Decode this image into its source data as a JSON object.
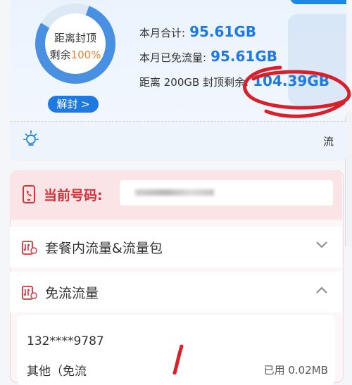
{
  "usage": {
    "ring_label_line1": "距离封顶",
    "ring_label_line2_prefix": "剩余",
    "ring_percent": "100%",
    "ring_fill_fraction": 0.78,
    "unlock_button": "解封",
    "unlock_chevron": ">",
    "month_total_label": "本月合计:",
    "month_total_value": "95.61GB",
    "month_free_label": "本月已免流量:",
    "month_free_value": "95.61GB",
    "cap_label": "距离 200GB 封顶剩余:",
    "cap_value": "104.39GB"
  },
  "tip": {
    "icon": "lightbulb-icon",
    "text": "流"
  },
  "number_panel": {
    "label": "当前号码:",
    "icon": "phone-icon"
  },
  "accordion": [
    {
      "title": "套餐内流量&流量包",
      "icon": "data-package-icon",
      "expanded": false
    },
    {
      "title": "免流流量",
      "icon": "free-data-icon",
      "expanded": true
    }
  ],
  "detail": {
    "number": "132****9787",
    "type": "其他（免流",
    "used": "已用 0.02MB"
  },
  "colors": {
    "accent_blue": "#1e7ae0",
    "accent_red": "#d9303a",
    "ring_orange": "#f0812f",
    "scribble_red": "#d8202a"
  }
}
